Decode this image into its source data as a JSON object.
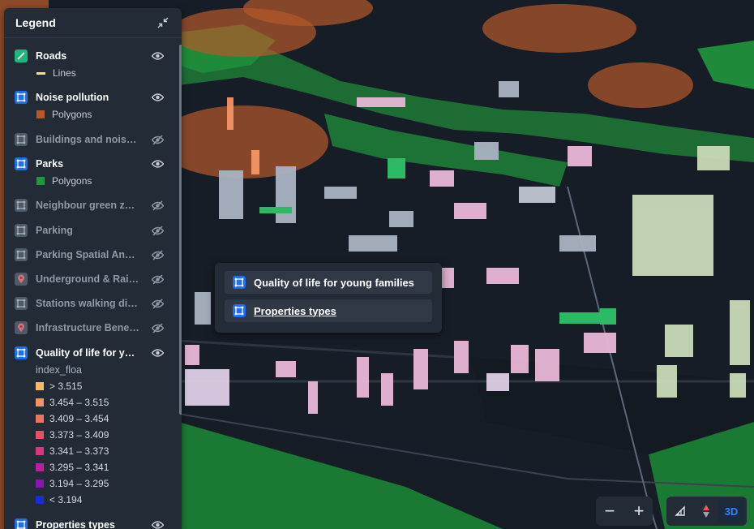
{
  "legend": {
    "title": "Legend",
    "layers": [
      {
        "name": "Roads",
        "visible": true,
        "icon": "polygon-layer-icon",
        "sub": "Lines",
        "sub_color": "#f7e37a"
      },
      {
        "name": "Noise pollution",
        "visible": true,
        "icon": "polygon-layer-icon",
        "sub": "Polygons",
        "sub_color": "#b5592b"
      },
      {
        "name": "Buildings and noise l...",
        "visible": false,
        "icon": "polygon-layer-icon"
      },
      {
        "name": "Parks",
        "visible": true,
        "icon": "polygon-layer-icon",
        "sub": "Polygons",
        "sub_color": "#1f9a3a"
      },
      {
        "name": "Neighbour green zones",
        "visible": false,
        "icon": "polygon-layer-icon"
      },
      {
        "name": "Parking",
        "visible": false,
        "icon": "polygon-layer-icon"
      },
      {
        "name": "Parking Spatial Analy...",
        "visible": false,
        "icon": "polygon-layer-icon"
      },
      {
        "name": "Underground & Railw...",
        "visible": false,
        "icon": "pin-icon"
      },
      {
        "name": "Stations walking dist...",
        "visible": false,
        "icon": "polygon-layer-icon"
      },
      {
        "name": "Infrastructure Benefits",
        "visible": false,
        "icon": "pin-icon"
      },
      {
        "name": "Quality of life for you...",
        "visible": true,
        "icon": "polygon-layer-icon"
      },
      {
        "name": "Properties types",
        "visible": true,
        "icon": "polygon-layer-icon"
      }
    ],
    "quality_field": "index_floa",
    "quality_classes": [
      {
        "label": "> 3.515",
        "color": "#f8b866"
      },
      {
        "label": "3.454 – 3.515",
        "color": "#f49464"
      },
      {
        "label": "3.409 – 3.454",
        "color": "#ee7460"
      },
      {
        "label": "3.373 – 3.409",
        "color": "#e6506a"
      },
      {
        "label": "3.341 – 3.373",
        "color": "#d63580"
      },
      {
        "label": "3.295 – 3.341",
        "color": "#b91e9d"
      },
      {
        "label": "3.194 – 3.295",
        "color": "#8b14b3"
      },
      {
        "label": "< 3.194",
        "color": "#1c2bd8"
      }
    ]
  },
  "popup": {
    "items": [
      "Quality of life for young families",
      "Properties types"
    ]
  },
  "map_controls": {
    "zoom_out": "−",
    "zoom_in": "+",
    "mode_3d": "3D"
  }
}
